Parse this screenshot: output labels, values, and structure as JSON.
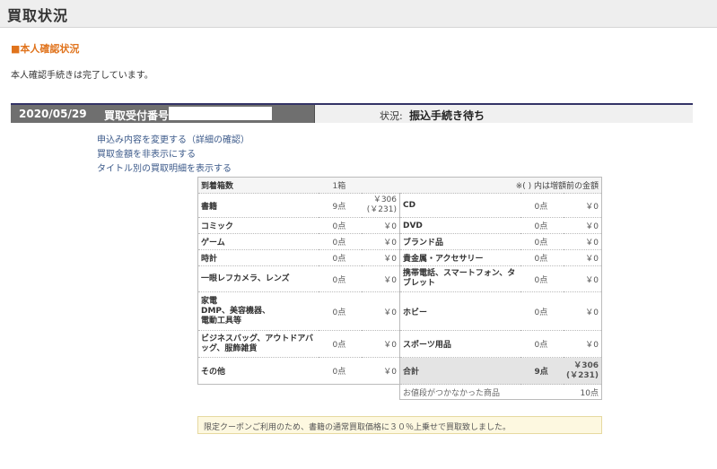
{
  "header": {
    "title": "買取状況"
  },
  "verification": {
    "heading": "■本人確認状況",
    "status": "本人確認手続きは完了しています。"
  },
  "order": {
    "date": "2020/05/29",
    "number_label": "買取受付番号：",
    "status_label": "状況:",
    "status_value": "振込手続き待ち"
  },
  "links": [
    "申込み内容を変更する（詳細の確認）",
    "買取金額を非表示にする",
    "タイトル別の買取明細を表示する"
  ],
  "table": {
    "arrival_label": "到着箱数",
    "arrival_value": "1箱",
    "note": "※( ) 内は増額前の金額",
    "rows": [
      {
        "l_name": "書籍",
        "l_count": "9点",
        "l_amount": "￥306",
        "l_amount_sub": "(￥231)",
        "r_name": "CD",
        "r_count": "0点",
        "r_amount": "￥0"
      },
      {
        "l_name": "コミック",
        "l_count": "0点",
        "l_amount": "￥0",
        "l_amount_sub": "",
        "r_name": "DVD",
        "r_count": "0点",
        "r_amount": "￥0"
      },
      {
        "l_name": "ゲーム",
        "l_count": "0点",
        "l_amount": "￥0",
        "l_amount_sub": "",
        "r_name": "ブランド品",
        "r_count": "0点",
        "r_amount": "￥0"
      },
      {
        "l_name": "時計",
        "l_count": "0点",
        "l_amount": "￥0",
        "l_amount_sub": "",
        "r_name": "貴金属・アクセサリー",
        "r_count": "0点",
        "r_amount": "￥0"
      },
      {
        "l_name": "一眼レフカメラ、レンズ",
        "l_count": "0点",
        "l_amount": "￥0",
        "l_amount_sub": "",
        "r_name": "携帯電話、スマートフォン、タブレット",
        "r_count": "0点",
        "r_amount": "￥0"
      },
      {
        "l_name": "家電\nDMP、美容機器、\n電動工具等",
        "l_count": "0点",
        "l_amount": "￥0",
        "l_amount_sub": "",
        "r_name": "ホビー",
        "r_count": "0点",
        "r_amount": "￥0"
      },
      {
        "l_name": "ビジネスバッグ、アウトドアバッグ、服飾雑貨",
        "l_count": "0点",
        "l_amount": "￥0",
        "l_amount_sub": "",
        "r_name": "スポーツ用品",
        "r_count": "0点",
        "r_amount": "￥0"
      }
    ],
    "other": {
      "name": "その他",
      "count": "0点",
      "amount": "￥0"
    },
    "total": {
      "label": "合計",
      "count": "9点",
      "amount": "￥306",
      "amount_sub": "(￥231)"
    },
    "no_price": {
      "label": "お値段がつかなかった商品",
      "count": "10点"
    }
  },
  "notice": "限定クーポンご利用のため、書籍の通常買取価格に３０％上乗せで買取致しました。"
}
